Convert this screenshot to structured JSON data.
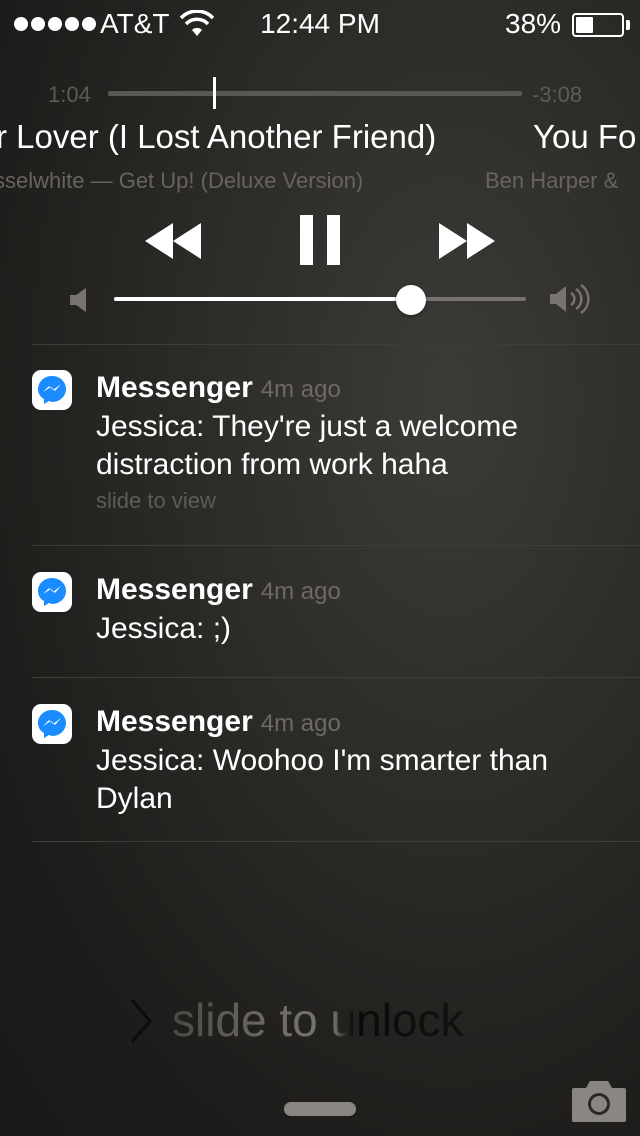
{
  "status_bar": {
    "carrier": "AT&T",
    "time": "12:44 PM",
    "battery_percent": "38%",
    "battery_level": 0.38,
    "signal_bars": 5
  },
  "now_playing": {
    "elapsed": "1:04",
    "remaining": "-3:08",
    "progress": 0.25,
    "title": "r Lover (I Lost Another Friend)",
    "artist_album": "sselwhite — Get Up! (Deluxe Version)",
    "next_title": "You Fo",
    "next_artist": "Ben Harper &",
    "volume": 0.72
  },
  "notifications": [
    {
      "app": "Messenger",
      "time_ago": "4m ago",
      "message": "Jessica: They're just a welcome distraction from work haha",
      "hint": "slide to view"
    },
    {
      "app": "Messenger",
      "time_ago": "4m ago",
      "message": "Jessica: ;)"
    },
    {
      "app": "Messenger",
      "time_ago": "4m ago",
      "message": "Jessica: Woohoo I'm smarter than Dylan"
    }
  ],
  "lock": {
    "slide_text": "slide to unlock"
  },
  "icons": {
    "wifi": "wifi-icon",
    "rewind": "rewind-icon",
    "pause": "pause-icon",
    "forward": "fast-forward-icon",
    "volume_low": "speaker-low-icon",
    "volume_high": "speaker-high-icon",
    "messenger": "messenger-icon",
    "chevron": "chevron-right-icon",
    "camera": "camera-icon"
  },
  "colors": {
    "messenger_blue": "#1a8cff"
  }
}
